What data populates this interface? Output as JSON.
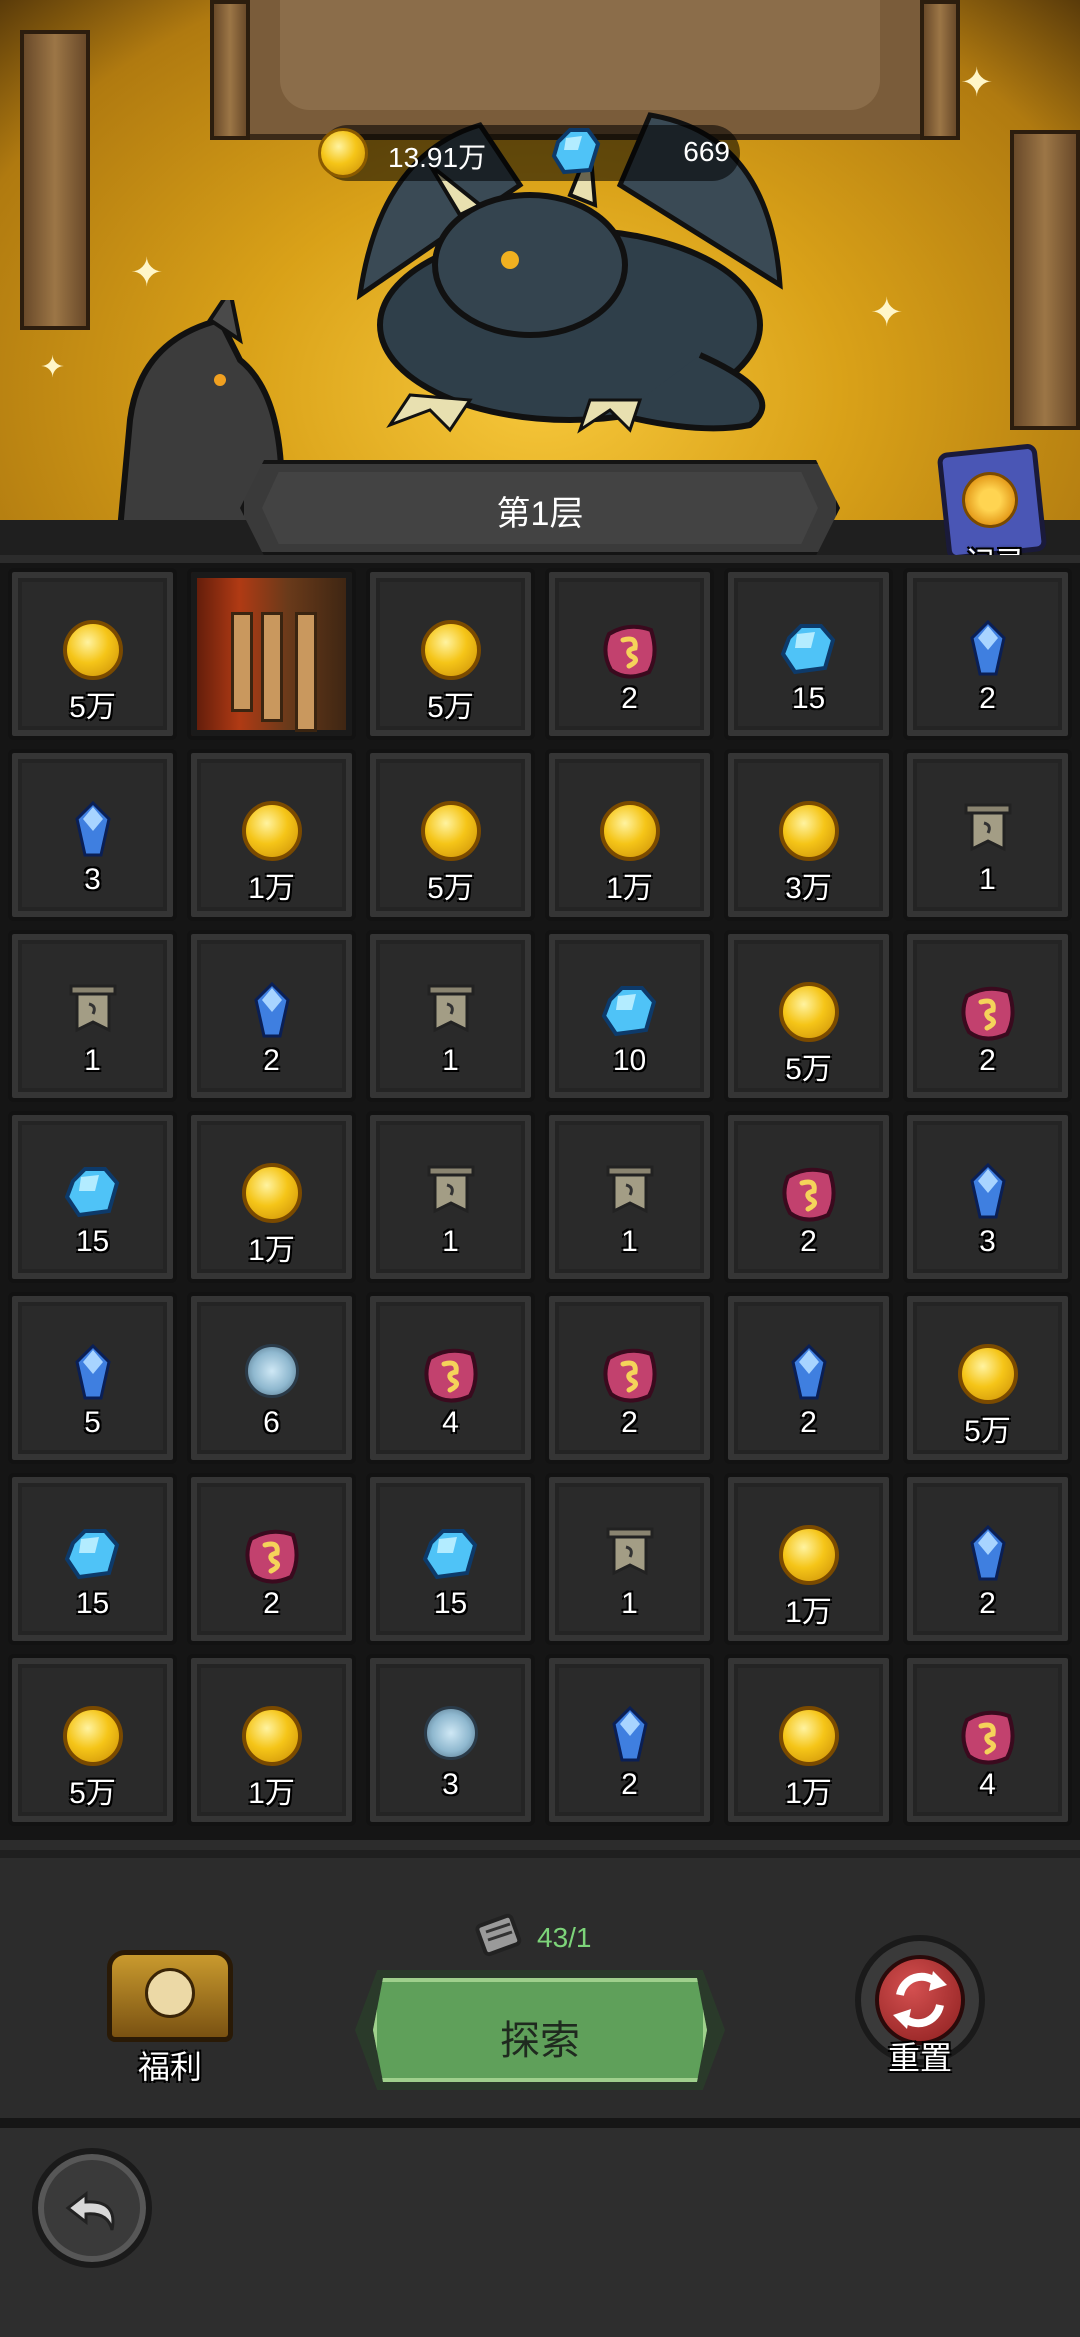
{
  "resources": {
    "coins": "13.91万",
    "gems": "669"
  },
  "floor": {
    "label": "第1层"
  },
  "record": {
    "label": "记录"
  },
  "grid": {
    "cells": [
      {
        "item": "coin",
        "count": "5万"
      },
      {
        "item": "opened",
        "count": ""
      },
      {
        "item": "coin",
        "count": "5万"
      },
      {
        "item": "rune",
        "count": "2"
      },
      {
        "item": "blue-gem",
        "count": "15"
      },
      {
        "item": "crystal",
        "count": "2"
      },
      {
        "item": "crystal",
        "count": "3"
      },
      {
        "item": "coin",
        "count": "1万"
      },
      {
        "item": "coin",
        "count": "5万"
      },
      {
        "item": "coin",
        "count": "1万"
      },
      {
        "item": "coin",
        "count": "3万"
      },
      {
        "item": "banner",
        "count": "1"
      },
      {
        "item": "banner",
        "count": "1"
      },
      {
        "item": "crystal",
        "count": "2"
      },
      {
        "item": "banner",
        "count": "1"
      },
      {
        "item": "blue-gem",
        "count": "10"
      },
      {
        "item": "coin",
        "count": "5万"
      },
      {
        "item": "rune",
        "count": "2"
      },
      {
        "item": "blue-gem",
        "count": "15"
      },
      {
        "item": "coin",
        "count": "1万"
      },
      {
        "item": "banner",
        "count": "1"
      },
      {
        "item": "banner",
        "count": "1"
      },
      {
        "item": "rune",
        "count": "2"
      },
      {
        "item": "crystal",
        "count": "3"
      },
      {
        "item": "crystal",
        "count": "5"
      },
      {
        "item": "swirl",
        "count": "6"
      },
      {
        "item": "rune",
        "count": "4"
      },
      {
        "item": "rune",
        "count": "2"
      },
      {
        "item": "crystal",
        "count": "2"
      },
      {
        "item": "coin",
        "count": "5万"
      },
      {
        "item": "blue-gem",
        "count": "15"
      },
      {
        "item": "rune",
        "count": "2"
      },
      {
        "item": "blue-gem",
        "count": "15"
      },
      {
        "item": "banner",
        "count": "1"
      },
      {
        "item": "coin",
        "count": "1万"
      },
      {
        "item": "crystal",
        "count": "2"
      },
      {
        "item": "coin",
        "count": "5万"
      },
      {
        "item": "coin",
        "count": "1万"
      },
      {
        "item": "swirl",
        "count": "3"
      },
      {
        "item": "crystal",
        "count": "2"
      },
      {
        "item": "coin",
        "count": "1万"
      },
      {
        "item": "rune",
        "count": "4"
      }
    ]
  },
  "controls": {
    "welfare_label": "福利",
    "explore_counter": "43/1",
    "explore_label": "探索",
    "reset_label": "重置"
  }
}
